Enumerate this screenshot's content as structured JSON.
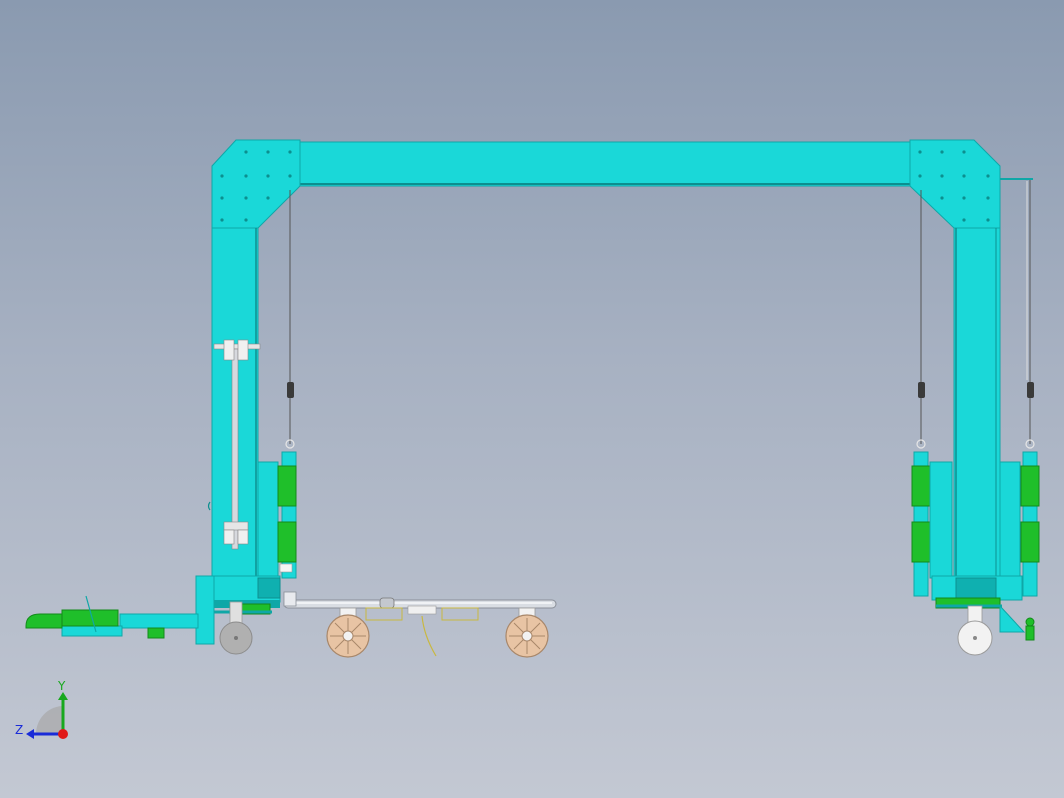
{
  "viewport": {
    "background_top": "#8a9ab0",
    "background_bottom": "#c3c8d3"
  },
  "colors": {
    "frame": "#1ad8d8",
    "frame_edge": "#0fa7a7",
    "frame_dark": "#0c8f8f",
    "cylinder_green": "#1fbf2a",
    "cylinder_green_dark": "#138a1b",
    "wheel_tan": "#e8c4a4",
    "wheel_grey": "#b0b0b0",
    "wheel_white": "#f2f2f2",
    "rail_silver": "#d9dde3",
    "cable": "#555555",
    "weight": "#3a3a3a",
    "yellow_line": "#c9b840"
  },
  "coordinate_triad": {
    "y_label": "Y",
    "z_label": "Z",
    "y_color": "#18a81e",
    "z_color": "#1a2bd8",
    "origin_color": "#e01818"
  }
}
